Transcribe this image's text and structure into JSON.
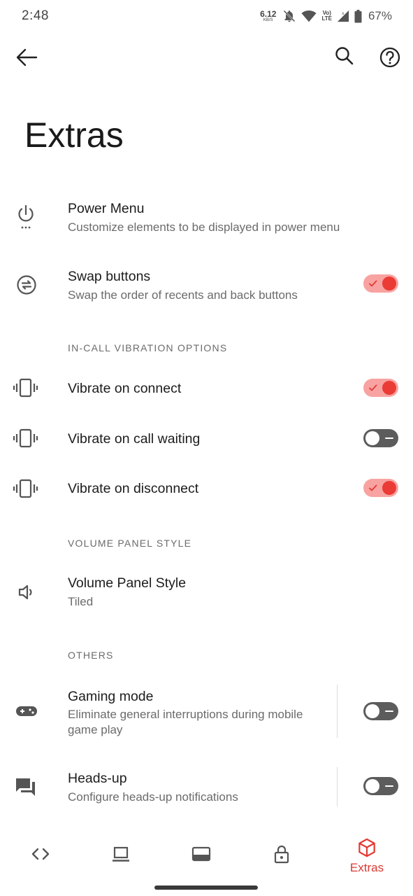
{
  "status_bar": {
    "time": "2:48",
    "net_speed": "6.12",
    "net_speed_unit": "KB/S",
    "volte_top": "Vo)",
    "volte_bottom": "LTE",
    "battery_percent": "67%",
    "icons": [
      "mute-bell-icon",
      "wifi-icon",
      "volte-icon",
      "signal-icon",
      "battery-icon"
    ]
  },
  "toolbar": {
    "back_icon": "arrow-left-icon",
    "search_icon": "search-icon",
    "help_icon": "help-circle-icon"
  },
  "page": {
    "title": "Extras"
  },
  "items": {
    "power_menu": {
      "title": "Power Menu",
      "subtitle": "Customize elements to be displayed in power menu",
      "icon": "power-icon"
    },
    "swap_buttons": {
      "title": "Swap buttons",
      "subtitle": "Swap the order of recents and back buttons",
      "icon": "swap-icon",
      "enabled": true
    },
    "vibrate_connect": {
      "title": "Vibrate on connect",
      "icon": "vibration-icon",
      "enabled": true
    },
    "vibrate_waiting": {
      "title": "Vibrate on call waiting",
      "icon": "vibration-icon",
      "enabled": false
    },
    "vibrate_disconnect": {
      "title": "Vibrate on disconnect",
      "icon": "vibration-icon",
      "enabled": true
    },
    "volume_panel": {
      "title": "Volume Panel Style",
      "subtitle": "Tiled",
      "icon": "volume-icon"
    },
    "gaming_mode": {
      "title": "Gaming mode",
      "subtitle": "Eliminate general interruptions during mobile game play",
      "icon": "gamepad-icon",
      "enabled": false
    },
    "heads_up": {
      "title": "Heads-up",
      "subtitle": "Configure heads-up notifications",
      "icon": "chat-icon",
      "enabled": false
    }
  },
  "sections": {
    "in_call": "IN-CALL VIBRATION OPTIONS",
    "volume": "VOLUME PANEL STYLE",
    "others": "OTHERS"
  },
  "bottom_nav": {
    "items": [
      {
        "icon": "code-icon",
        "label": ""
      },
      {
        "icon": "laptop-icon",
        "label": ""
      },
      {
        "icon": "navbar-icon",
        "label": ""
      },
      {
        "icon": "lock-icon",
        "label": ""
      },
      {
        "icon": "cube-icon",
        "label": "Extras",
        "active": true
      }
    ]
  },
  "colors": {
    "accent": "#e53935",
    "toggle_on_track": "#f8a3a1",
    "toggle_on_knob": "#ea3b35",
    "toggle_off_track": "#5c5c5c",
    "text_primary": "#1c1c1c",
    "text_secondary": "#6b6b6b"
  }
}
